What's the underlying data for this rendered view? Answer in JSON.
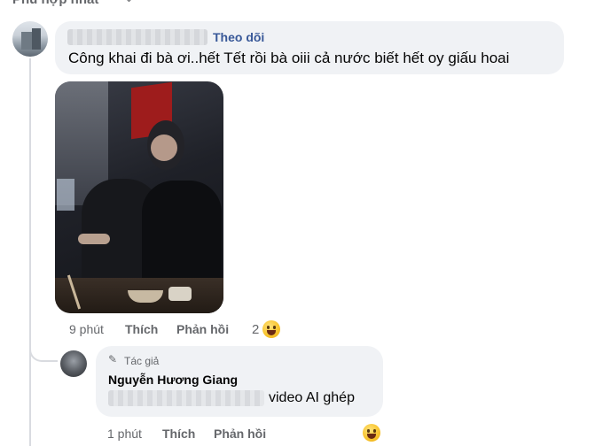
{
  "sort": {
    "label": "Phù hợp nhất",
    "icon": "chevron-down-icon"
  },
  "comment": {
    "follow_label": "Theo dõi",
    "text": "Công khai đi bà ơi..hết Tết rồi bà oiii cả nước biết hết oy giấu hoai",
    "time": "9 phút",
    "like_label": "Thích",
    "reply_label": "Phản hồi",
    "reaction_count": "2",
    "reaction_icon": "laughing-emoji-icon"
  },
  "reply": {
    "author_badge": "Tác giả",
    "author_badge_icon": "pencil-icon",
    "author_name": "Nguyễn Hương Giang",
    "text": "video AI ghép",
    "time": "1 phút",
    "like_label": "Thích",
    "reply_label": "Phản hồi",
    "reaction_icon": "laughing-emoji-icon"
  },
  "colors": {
    "bubble": "#f0f2f5",
    "link": "#385898",
    "meta": "#65676b",
    "text": "#050505"
  }
}
